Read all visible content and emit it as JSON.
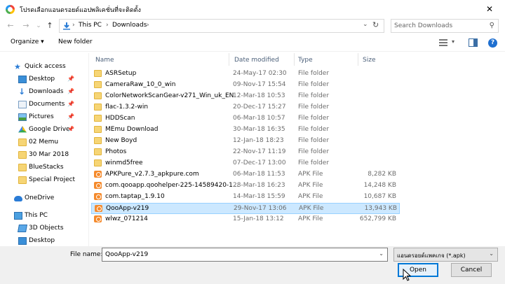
{
  "window": {
    "title": "โปรดเลือกแอนดรอยด์แอปพลิเคชั่นที่จะติดตั้ง",
    "close_glyph": "✕"
  },
  "nav": {
    "back_glyph": "←",
    "forward_glyph": "→",
    "recent_glyph": "⌄",
    "up_glyph": "↑",
    "breadcrumb": [
      "This PC",
      "Downloads"
    ],
    "separator": "›",
    "dropdown_glyph": "⌄",
    "refresh_glyph": "↻"
  },
  "search": {
    "placeholder": "Search Downloads",
    "icon_glyph": "⚲"
  },
  "toolbar": {
    "organize_label": "Organize ▾",
    "new_folder_label": "New folder",
    "view_dropdown_glyph": "▾",
    "help_glyph": "?"
  },
  "sidebar": {
    "items": [
      {
        "label": "Quick access",
        "icon": "star-icon",
        "pinned": false
      },
      {
        "label": "Desktop",
        "icon": "desktop-icon",
        "pinned": true
      },
      {
        "label": "Downloads",
        "icon": "download-icon",
        "pinned": true
      },
      {
        "label": "Documents",
        "icon": "document-icon",
        "pinned": true
      },
      {
        "label": "Pictures",
        "icon": "pictures-icon",
        "pinned": true
      },
      {
        "label": "Google Drive",
        "icon": "google-drive-icon",
        "pinned": true
      },
      {
        "label": "02 Memu",
        "icon": "folder-icon",
        "pinned": false
      },
      {
        "label": "30 Mar 2018",
        "icon": "folder-icon",
        "pinned": false
      },
      {
        "label": "BlueStacks",
        "icon": "folder-icon",
        "pinned": false
      },
      {
        "label": "Special Project",
        "icon": "folder-icon",
        "pinned": false
      },
      {
        "label": "OneDrive",
        "icon": "onedrive-icon",
        "pinned": false
      },
      {
        "label": "This PC",
        "icon": "this-pc-icon",
        "pinned": false
      },
      {
        "label": "3D Objects",
        "icon": "3d-objects-icon",
        "pinned": false
      },
      {
        "label": "Desktop",
        "icon": "desktop-icon",
        "pinned": false
      }
    ],
    "pin_glyph": "📌"
  },
  "columns": {
    "name": "Name",
    "date": "Date modified",
    "type": "Type",
    "size": "Size",
    "sort_glyph": "^"
  },
  "files": [
    {
      "name": "ASRSetup",
      "date": "24-May-17 02:30",
      "type": "File folder",
      "size": "",
      "kind": "folder"
    },
    {
      "name": "CameraRaw_10_0_win",
      "date": "09-Nov-17 15:54",
      "type": "File folder",
      "size": "",
      "kind": "folder"
    },
    {
      "name": "ColorNetworkScanGear-v271_Win_uk_EN",
      "date": "12-Mar-18 10:53",
      "type": "File folder",
      "size": "",
      "kind": "folder"
    },
    {
      "name": "flac-1.3.2-win",
      "date": "20-Dec-17 15:27",
      "type": "File folder",
      "size": "",
      "kind": "folder"
    },
    {
      "name": "HDDScan",
      "date": "06-Mar-18 10:57",
      "type": "File folder",
      "size": "",
      "kind": "folder"
    },
    {
      "name": "MEmu Download",
      "date": "30-Mar-18 16:35",
      "type": "File folder",
      "size": "",
      "kind": "folder"
    },
    {
      "name": "New Boyd",
      "date": "12-Jan-18 18:23",
      "type": "File folder",
      "size": "",
      "kind": "folder"
    },
    {
      "name": "Photos",
      "date": "22-Nov-17 11:19",
      "type": "File folder",
      "size": "",
      "kind": "folder"
    },
    {
      "name": "winmd5free",
      "date": "07-Dec-17 13:00",
      "type": "File folder",
      "size": "",
      "kind": "folder"
    },
    {
      "name": "APKPure_v2.7.3_apkpure.com",
      "date": "06-Mar-18 11:53",
      "type": "APK File",
      "size": "8,282 KB",
      "kind": "apk"
    },
    {
      "name": "com.qooapp.qoohelper-225-14589420-1...",
      "date": "28-Mar-18 16:23",
      "type": "APK File",
      "size": "14,248 KB",
      "kind": "apk"
    },
    {
      "name": "com.taptap_1.9.10",
      "date": "14-Mar-18 15:59",
      "type": "APK File",
      "size": "10,687 KB",
      "kind": "apk"
    },
    {
      "name": "QooApp-v219",
      "date": "29-Nov-17 13:06",
      "type": "APK File",
      "size": "13,943 KB",
      "kind": "apk",
      "selected": true
    },
    {
      "name": "wlwz_071214",
      "date": "15-Jan-18 13:12",
      "type": "APK File",
      "size": "652,799 KB",
      "kind": "apk"
    }
  ],
  "footer": {
    "file_name_label": "File name:",
    "file_name_value": "QooApp-v219",
    "dropdown_glyph": "⌄",
    "file_type_value": "แอนดรอยด์แพคเกจ (*.apk)",
    "open_label": "Open",
    "cancel_label": "Cancel"
  }
}
